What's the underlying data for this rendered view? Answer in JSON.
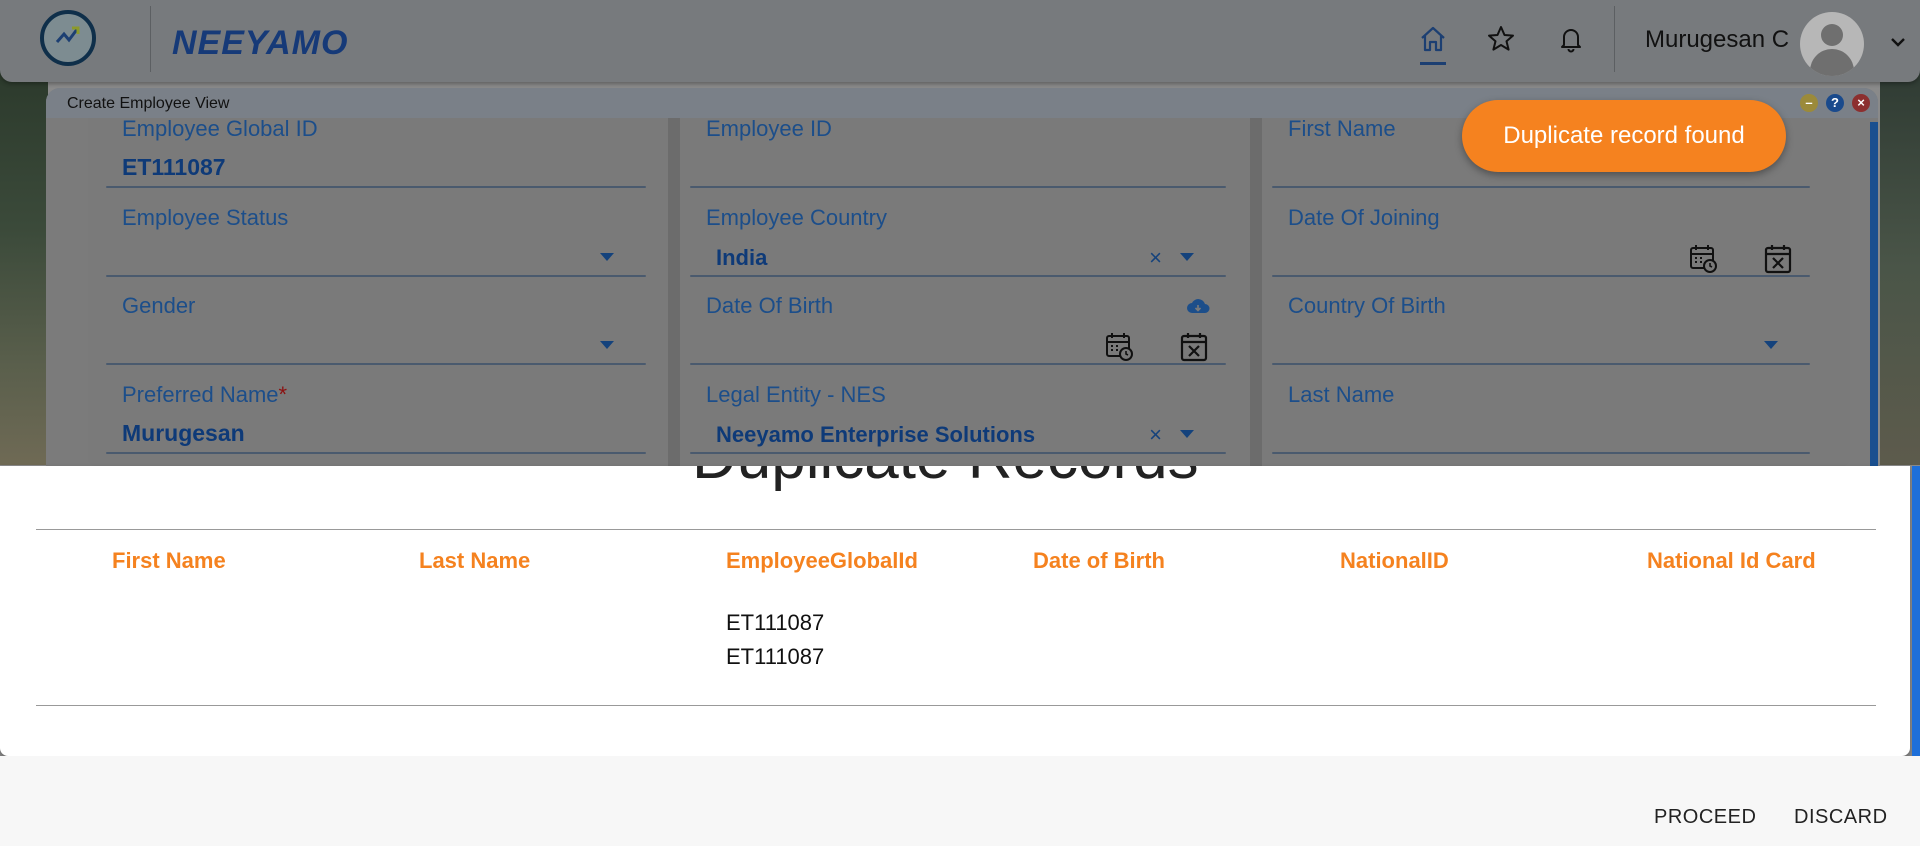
{
  "header": {
    "brand": "NEEYAMO",
    "user_name": "Murugesan C",
    "nav_icons": [
      "home-icon",
      "star-icon",
      "bell-icon"
    ]
  },
  "dialog": {
    "title": "Create Employee View",
    "window_buttons": [
      "minimize-icon",
      "help-icon",
      "close-icon"
    ],
    "fields": {
      "employee_global_id": {
        "label": "Employee Global ID",
        "value": "ET111087"
      },
      "employee_id": {
        "label": "Employee ID",
        "value": ""
      },
      "first_name": {
        "label": "First Name",
        "value": ""
      },
      "employee_status": {
        "label": "Employee Status",
        "value": ""
      },
      "employee_country": {
        "label": "Employee Country",
        "value": "India"
      },
      "date_of_joining": {
        "label": "Date Of Joining",
        "value": ""
      },
      "gender": {
        "label": "Gender",
        "value": ""
      },
      "date_of_birth": {
        "label": "Date Of Birth",
        "value": ""
      },
      "country_of_birth": {
        "label": "Country Of Birth",
        "value": ""
      },
      "preferred_name": {
        "label": "Preferred Name",
        "required_mark": "*",
        "value": "Murugesan"
      },
      "legal_entity": {
        "label": "Legal Entity - NES",
        "value": "Neeyamo Enterprise Solutions"
      },
      "last_name": {
        "label": "Last Name",
        "value": ""
      }
    }
  },
  "toast": {
    "text": "Duplicate record found"
  },
  "duplicates": {
    "heading": "Duplicate Records",
    "columns": [
      "First Name",
      "Last Name",
      "EmployeeGlobalId",
      "Date of Birth",
      "NationalID",
      "National Id Card"
    ],
    "rows": [
      {
        "first_name": "",
        "last_name": "",
        "employee_global_id": "ET111087",
        "date_of_birth": "",
        "national_id": "",
        "national_id_card": ""
      },
      {
        "first_name": "",
        "last_name": "",
        "employee_global_id": "ET111087",
        "date_of_birth": "",
        "national_id": "",
        "national_id_card": ""
      }
    ]
  },
  "actions": {
    "proceed": "PROCEED",
    "discard": "DISCARD"
  },
  "colors": {
    "accent_orange": "#f5821f",
    "field_blue": "#1c4e8a",
    "brand_navy": "#163a78"
  }
}
